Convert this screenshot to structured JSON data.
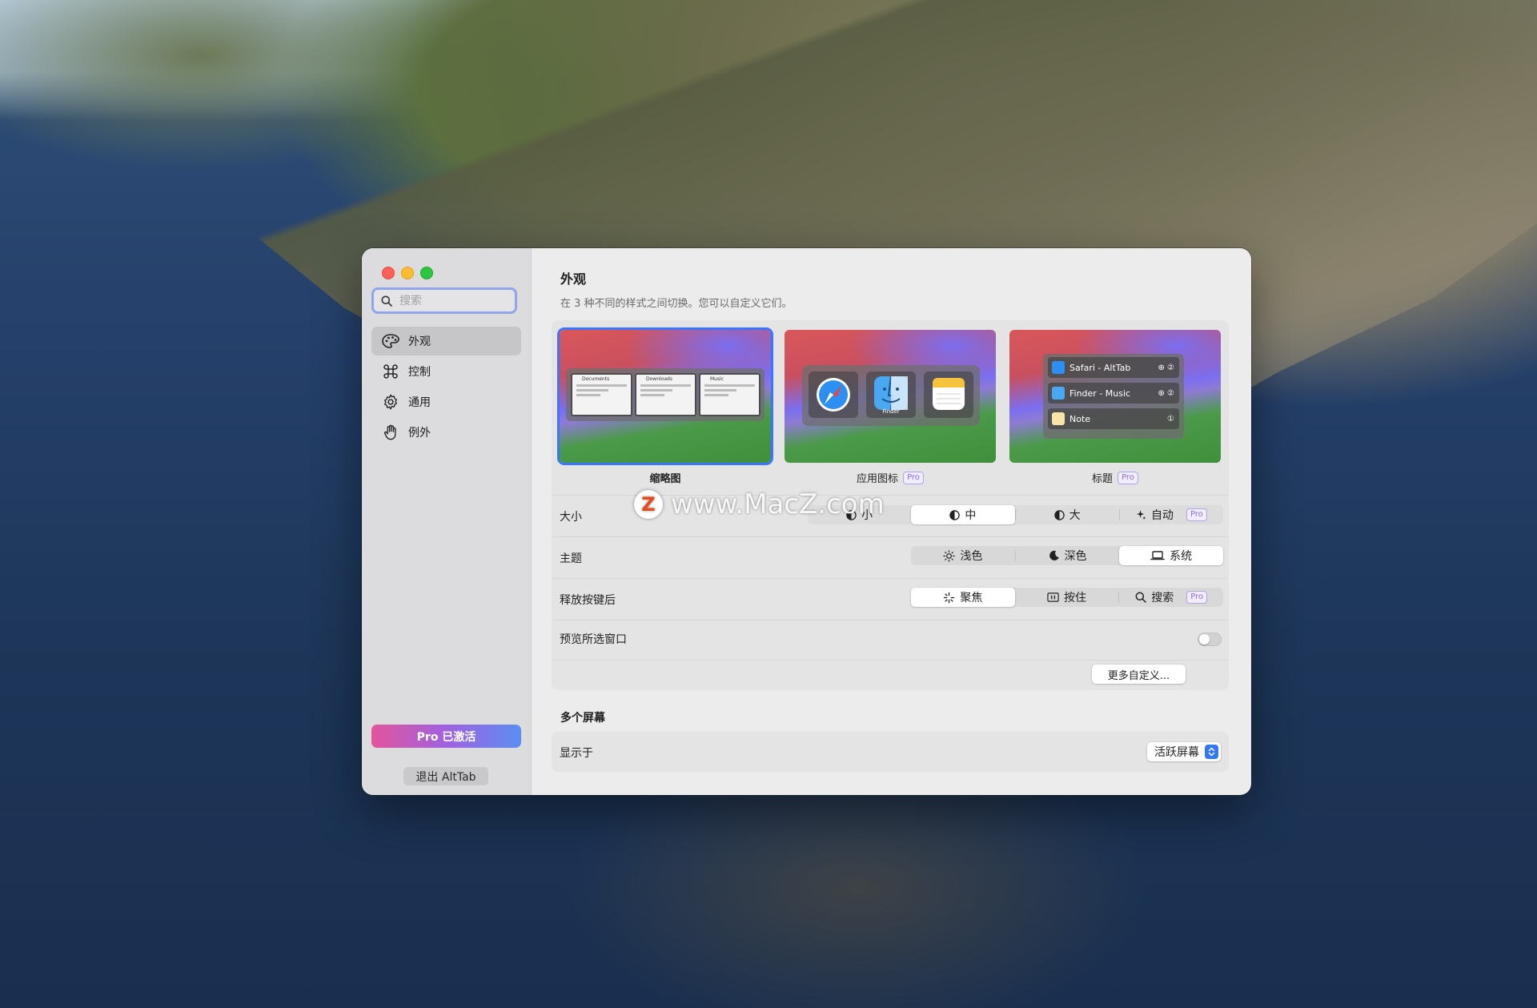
{
  "sidebar": {
    "search_placeholder": "搜索",
    "items": [
      {
        "label": "外观",
        "active": true
      },
      {
        "label": "控制",
        "active": false
      },
      {
        "label": "通用",
        "active": false
      },
      {
        "label": "例外",
        "active": false
      }
    ],
    "pro_button": "Pro 已激活",
    "quit_button": "退出 AltTab"
  },
  "main": {
    "title": "外观",
    "subtitle": "在 3 种不同的样式之间切换。您可以自定义它们。",
    "styles": [
      {
        "label": "缩略图",
        "pro": false,
        "selected": true
      },
      {
        "label": "应用图标",
        "pro": true,
        "selected": false
      },
      {
        "label": "标题",
        "pro": true,
        "selected": false
      }
    ],
    "pro_badge": "Pro",
    "thumbnail_titles": [
      "Documents",
      "Downloads",
      "Music"
    ],
    "finder_label": "Finder",
    "title_rows": [
      {
        "text": "Safari - AltTab",
        "icon": "safari-icon",
        "count": "⊕ ②"
      },
      {
        "text": "Finder - Music",
        "icon": "finder-icon",
        "count": "⊕ ②"
      },
      {
        "text": "Note",
        "icon": "notes-icon",
        "count": "①"
      }
    ],
    "size": {
      "label": "大小",
      "options": [
        "小",
        "中",
        "大",
        "自动"
      ],
      "selected": "中"
    },
    "theme": {
      "label": "主题",
      "options": [
        "浅色",
        "深色",
        "系统"
      ],
      "selected": "系统"
    },
    "release": {
      "label": "释放按键后",
      "options": [
        "聚焦",
        "按住",
        "搜索"
      ],
      "selected": "聚焦"
    },
    "preview": {
      "label": "预览所选窗口",
      "enabled": false
    },
    "more_button": "更多自定义...",
    "multi_screen": {
      "title": "多个屏幕",
      "show_on_label": "显示于",
      "show_on_value": "活跃屏幕"
    }
  },
  "watermark": {
    "logo": "Z",
    "text": "www.MacZ.com"
  },
  "colors": {
    "accent": "#3b74ff",
    "pro_gradient_start": "#e2559b",
    "pro_gradient_end": "#5b8ef2"
  }
}
